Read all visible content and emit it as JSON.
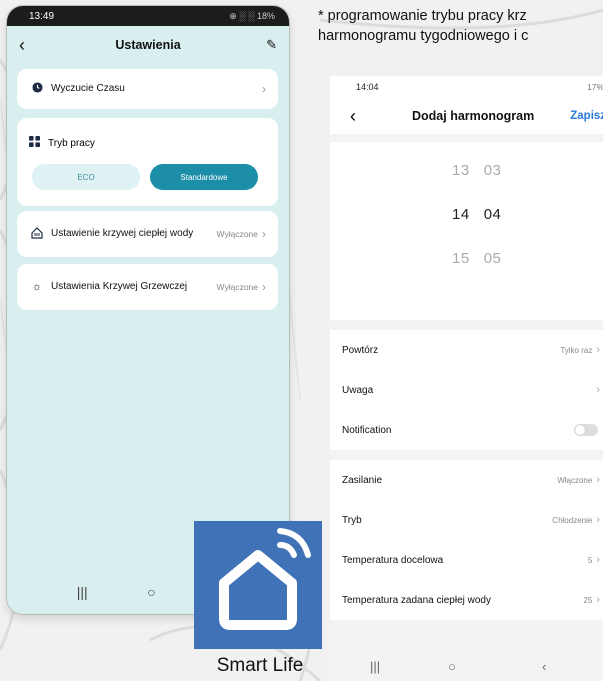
{
  "caption": {
    "line1": "* programowanie trybu pracy krz",
    "line2": "harmonogramu tygodniowego i c"
  },
  "phone1": {
    "status": {
      "time": "13:49",
      "indicators": "⊕ ░ ░ 18%"
    },
    "header": {
      "title": "Ustawienia"
    },
    "time_sense": {
      "label": "Wyczucie Czasu"
    },
    "mode": {
      "label": "Tryb pracy",
      "options": [
        "ECO",
        "Standardowe"
      ],
      "selected": "Standardowe"
    },
    "hot_water_curve": {
      "label": "Ustawienie krzywej ciepłej wody",
      "value": "Wyłączone"
    },
    "heating_curve": {
      "label": "Ustawienia Krzywej Grzewczej",
      "value": "Wyłączone"
    }
  },
  "phone2": {
    "status": {
      "time": "14:04",
      "battery": "17%"
    },
    "header": {
      "title": "Dodaj harmonogram",
      "save": "Zapisz"
    },
    "picker": [
      {
        "hour": "13",
        "minute": "03"
      },
      {
        "hour": "14",
        "minute": "04"
      },
      {
        "hour": "15",
        "minute": "05"
      }
    ],
    "rows1": [
      {
        "label": "Powtórz",
        "value": "Tylko raz"
      },
      {
        "label": "Uwaga",
        "value": ""
      }
    ],
    "notification": {
      "label": "Notification",
      "enabled": false
    },
    "rows2": [
      {
        "label": "Zasilanie",
        "value": "Włączone"
      },
      {
        "label": "Tryb",
        "value": "Chłodzenie"
      },
      {
        "label": "Temperatura docelowa",
        "value": "5"
      },
      {
        "label": "Temperatura zadana ciepłej wody",
        "value": "25"
      }
    ]
  },
  "logo": {
    "caption": "Smart Life",
    "color": "#3f72b7"
  }
}
